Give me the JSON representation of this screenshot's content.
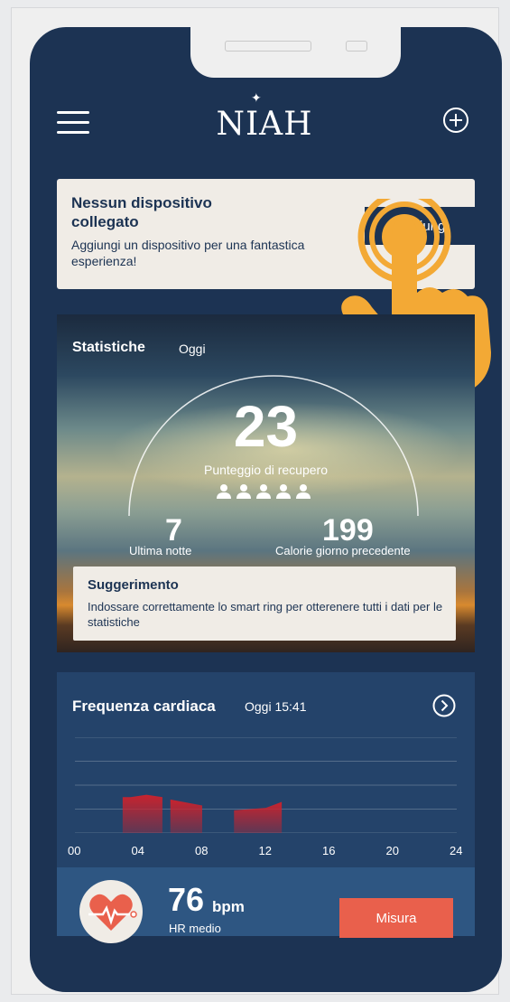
{
  "app": {
    "logo_text": "NIAH",
    "menu_icon": "hamburger-menu-icon",
    "add_icon": "plus-circle-icon"
  },
  "device_card": {
    "title": "Nessun dispositivo collegato",
    "subtitle": "Aggiungi un dispositivo per una fantastica esperienza!",
    "button_label": "Aggiungi"
  },
  "stats": {
    "title": "Statistiche",
    "period": "Oggi",
    "score": "23",
    "score_label": "Punteggio di recupero",
    "left_value": "7",
    "left_label": "Ultima notte",
    "right_value": "199",
    "right_label": "Calorie giorno precedente",
    "tip_title": "Suggerimento",
    "tip_text": "Indossare correttamente lo smart ring per otterenere tutti i dati per le statistiche"
  },
  "heart_rate": {
    "title": "Frequenza cardiaca",
    "period": "Oggi  15:41",
    "next_icon": "chevron-right-circle-icon",
    "bpm_value": "76",
    "bpm_unit": "bpm",
    "bpm_label": "HR medio",
    "measure_label": "Misura",
    "heart_icon": "heart-pulse-icon"
  },
  "chart_data": {
    "type": "area",
    "x_tick_labels": [
      "00",
      "04",
      "08",
      "12",
      "16",
      "20",
      "24"
    ],
    "xlim": [
      0,
      24
    ],
    "ylim": [
      0,
      4
    ],
    "grid": true,
    "series": [
      {
        "x": [
          3,
          3.5,
          4.5,
          5.5,
          5.5
        ],
        "y": [
          1.5,
          1.5,
          1.6,
          1.5,
          1.5
        ]
      },
      {
        "x": [
          6,
          6,
          8,
          8
        ],
        "y": [
          1.4,
          1.4,
          1.15,
          1.15
        ]
      },
      {
        "x": [
          10,
          10,
          12,
          13,
          13
        ],
        "y": [
          0.95,
          0.95,
          1.05,
          1.3,
          1.3
        ]
      }
    ],
    "color": "#c7232e"
  }
}
